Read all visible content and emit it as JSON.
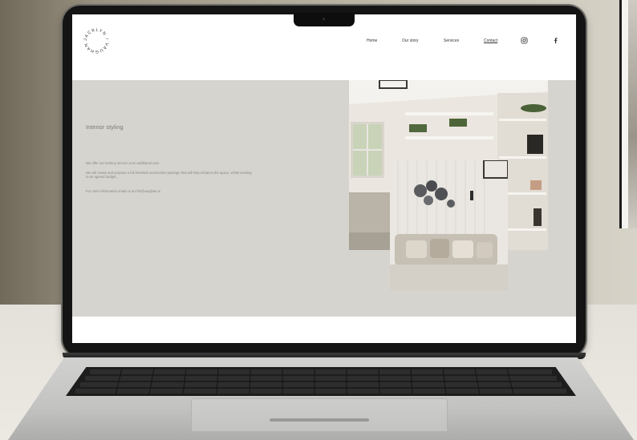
{
  "site": {
    "logo_text": "JACKLYN / VAUGHAN",
    "nav": {
      "home": "Home",
      "our_story": "Our story",
      "services": "Services",
      "contact": "Contact"
    },
    "social_icons": [
      "instagram-icon",
      "facebook-icon"
    ]
  },
  "content": {
    "title": "Interior styling",
    "paragraphs": [
      "We offer our turnkey service at an additional cost.",
      "We will create and propose a full itemised accessories package that will help enhance the space, whilst working to an agreed budget.",
      "For more information email us at info@vaughan.ie"
    ]
  },
  "colors": {
    "content_bg": "#d6d4cf",
    "header_bg": "#ffffff",
    "text_muted": "#8a8883",
    "laptop_bezel": "#141414"
  }
}
